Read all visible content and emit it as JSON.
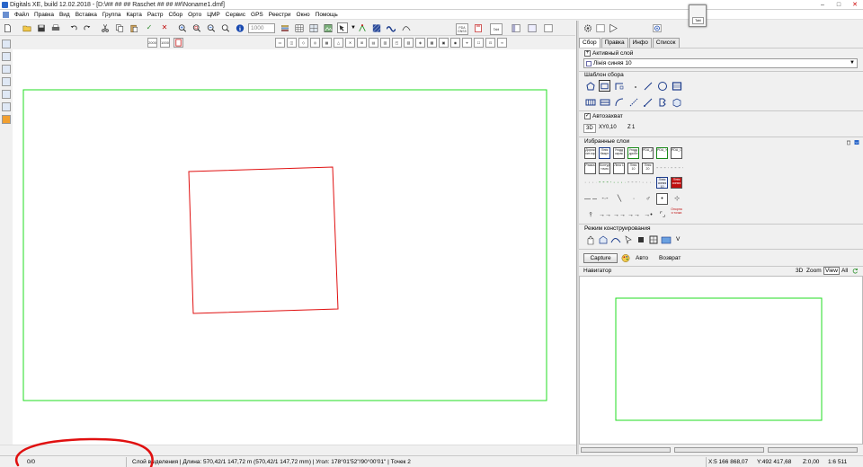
{
  "window": {
    "title": "Digitals XE, build 12.02.2018 - [D:\\## ## ##   Raschet   ## ## ##\\Noname1.dmf]",
    "min_label": "–",
    "max_label": "□",
    "close_label": "✕"
  },
  "menu": [
    "Файл",
    "Правка",
    "Вид",
    "Вставка",
    "Группа",
    "Карта",
    "Растр",
    "Сбор",
    "Орто",
    "ЦМР",
    "Сервис",
    "GPS",
    "Реестри",
    "Окно",
    "Помощь"
  ],
  "toolbar": {
    "zoom_value": "1000",
    "btn_fixed_label": "Fixed",
    "btn_tabl_label": "Tabl",
    "btn_gps_label": "PDA GNSS",
    "btn_2000": "2000",
    "btn_1000": "1000"
  },
  "floating_window": {
    "label": "Tabl"
  },
  "panel": {
    "tabs": [
      "Сбор",
      "Правка",
      "Инфо",
      "Список"
    ],
    "active_layer_label": "Активный слой",
    "active_layer_toggle": "+",
    "active_layer_value": "Лінія синяя 10",
    "template_label": "Шаблон сбора",
    "autocapture_label": "Автозахват",
    "autocapture_check": "✓",
    "mode_3d": "3D",
    "xy_label": "XY",
    "xy_value": "0,10",
    "z_label": "Z",
    "z_value": "1",
    "favorites_label": "Избранные слои",
    "favorites_text": [
      "Дорож хит.хор",
      "Лінія Кварт",
      "Угодд окрак",
      "Угодд дробн",
      "PDA_Доли",
      "PDA_Угодь",
      "PDA_Оцінка",
      "Рамка",
      "Контур точек",
      "Лінія 1",
      "Лінія 10",
      "Лінія 20",
      "Лінія синяя 10",
      "Лінія синяя",
      "Опорна я точка"
    ],
    "construction_label": "Режим конструирования",
    "construction_v": "V",
    "capture_btn": "Capture",
    "auto_label": "Авто",
    "return_label": "Возврат",
    "navigator_label": "Навигатор",
    "nav_3d": "3D",
    "nav_zoom": "Zoom",
    "nav_view": "View",
    "nav_all": "All"
  },
  "status": {
    "counter": "0/0",
    "selection_info": "Слой выделения | Длина: 570,42/1 147,72 m (570,42/1 147,72 mm) | Угол: 178°01'52\"/90°00'01\" | Точек 2",
    "x": "X:5 166 868,07",
    "y": "Y:492 417,68",
    "z": "Z:0,00",
    "scale": "1:6 511"
  },
  "colors": {
    "frame": "#22dd22",
    "polygon": "#e01010",
    "annotation": "#e01010",
    "accent_blue": "#2a66c9"
  },
  "icons": {
    "new": "new-file-icon",
    "open": "open-folder-icon",
    "save": "save-icon",
    "print": "print-icon",
    "undo": "undo-icon",
    "redo": "redo-icon",
    "cut": "scissors-icon",
    "copy": "copy-icon",
    "paste": "paste-icon",
    "apply": "checkmark-icon",
    "cancel": "cross-icon",
    "zoom_in": "zoom-in-icon",
    "zoom_out": "zoom-out-icon",
    "zoom_window": "zoom-window-icon",
    "info": "info-icon"
  }
}
